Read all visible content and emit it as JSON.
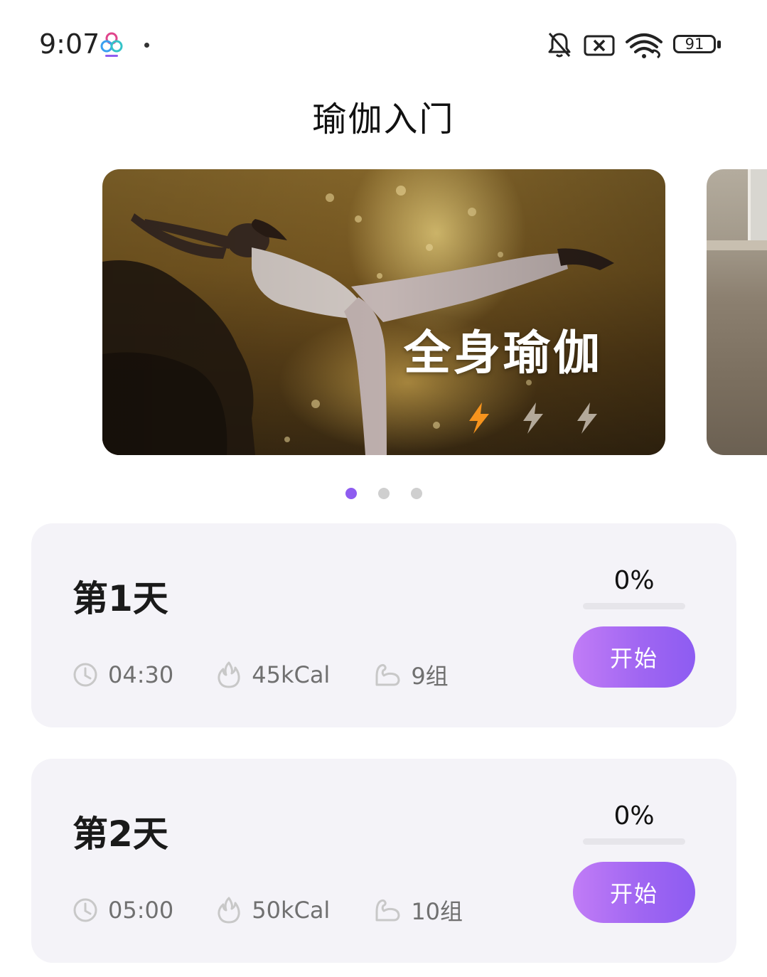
{
  "status_bar": {
    "time": "9:07",
    "battery_level": "91",
    "icons": [
      "app-notification-icon",
      "mute-bell-icon",
      "sim-disabled-icon",
      "wifi-icon",
      "battery-icon"
    ]
  },
  "header": {
    "title": "瑜伽入门"
  },
  "carousel": {
    "active_index": 0,
    "page_count": 3,
    "slides": [
      {
        "title": "全身瑜伽",
        "difficulty": 1,
        "difficulty_max": 3
      }
    ]
  },
  "days": [
    {
      "title": "第1天",
      "duration": "04:30",
      "calories": "45kCal",
      "groups": "9组",
      "percent": "0%",
      "progress": 0,
      "button": "开始"
    },
    {
      "title": "第2天",
      "duration": "05:00",
      "calories": "50kCal",
      "groups": "10组",
      "percent": "0%",
      "progress": 0,
      "button": "开始"
    }
  ],
  "colors": {
    "accent": "#8e5cf0",
    "button_gradient_start": "#c17cf6",
    "button_gradient_end": "#8d5cf2",
    "difficulty_active": "#f7941d",
    "card_background": "#f4f3f8"
  }
}
